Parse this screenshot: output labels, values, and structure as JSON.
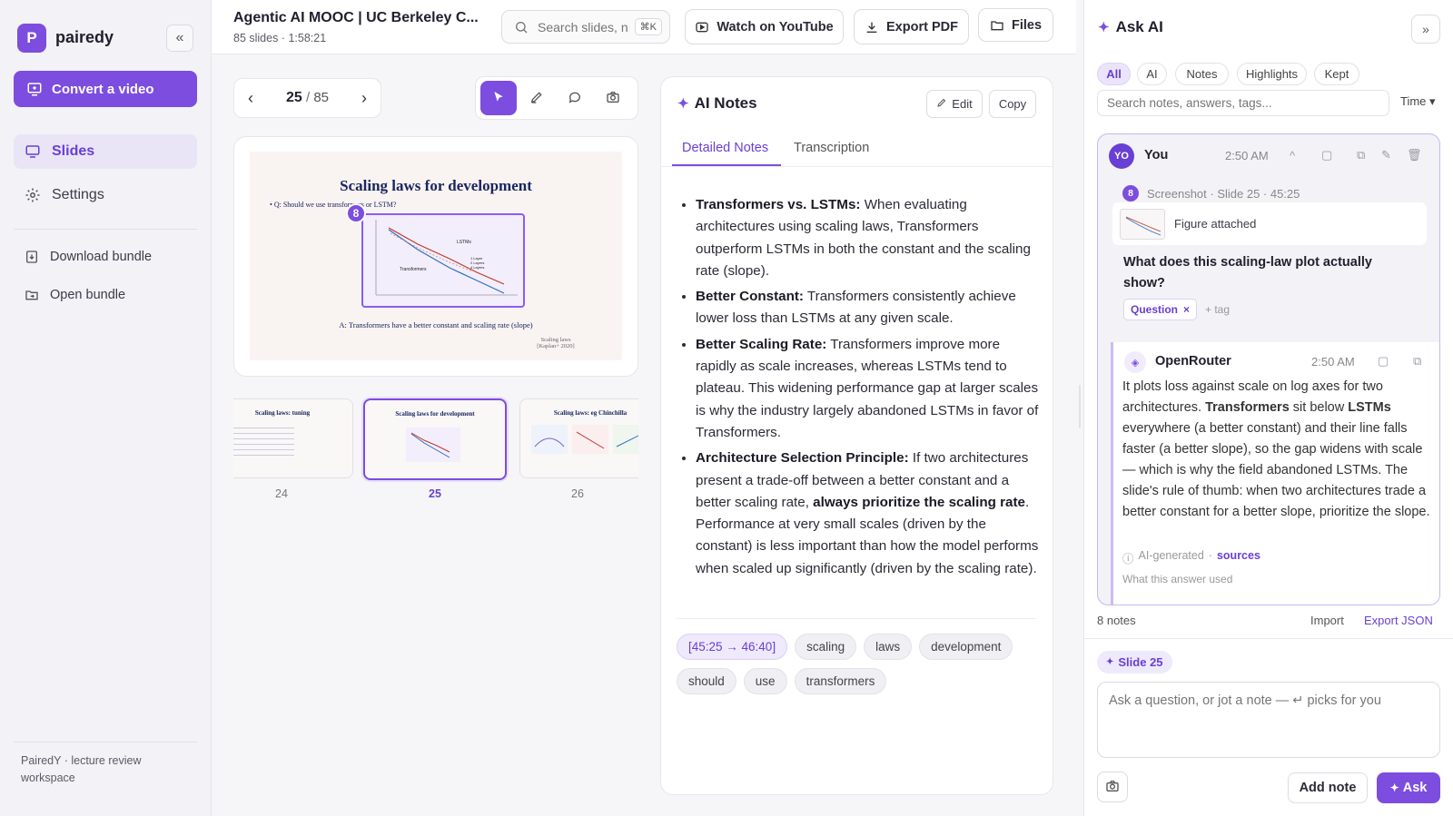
{
  "app": {
    "name": "pairedy",
    "logo_letter": "P",
    "accent": "#7c4ddf"
  },
  "sidebar": {
    "convert_label": "Convert a video",
    "nav": [
      {
        "label": "Slides",
        "icon": "monitor-icon",
        "active": true
      },
      {
        "label": "Settings",
        "icon": "gear-icon",
        "active": false
      }
    ],
    "actions": [
      {
        "label": "Download bundle",
        "icon": "download-icon"
      },
      {
        "label": "Open bundle",
        "icon": "folder-open-icon"
      }
    ],
    "footer": "PairedY · lecture review workspace"
  },
  "header": {
    "title": "Agentic AI MOOC | UC Berkeley C...",
    "subtitle": "85 slides · 1:58:21",
    "search_placeholder": "Search slides, n",
    "search_shortcut": "⌘K",
    "watch_label": "Watch on YouTube",
    "export_label": "Export PDF",
    "files_label": "Files"
  },
  "pager": {
    "current": "25",
    "separator": "/",
    "total": "85"
  },
  "slide": {
    "title": "Scaling laws for development",
    "bullet": "Q: Should we use transformers or LSTM?",
    "marker": "8",
    "series_lstm": "LSTMs",
    "series_transformers": "Transformers",
    "layer_labels": [
      "1 Layer",
      "2 Layers",
      "4 Layers"
    ],
    "answer": "A: Transformers have a better constant and scaling rate (slope)",
    "citation": "Scaling laws [Kaplan+ 2020]"
  },
  "thumbnails": [
    {
      "num": "24",
      "title": "Scaling laws: tuning"
    },
    {
      "num": "25",
      "title": "Scaling laws for development"
    },
    {
      "num": "26",
      "title": "Scaling laws: eg Chinchilla"
    }
  ],
  "notes": {
    "title": "AI Notes",
    "edit_label": "Edit",
    "copy_label": "Copy",
    "tabs": [
      "Detailed Notes",
      "Transcription"
    ],
    "bullets": [
      {
        "head": "Transformers vs. LSTMs:",
        "text": " When evaluating architectures using scaling laws, Transformers outperform LSTMs in both the constant and the scaling rate (slope)."
      },
      {
        "head": "Better Constant:",
        "text": " Transformers consistently achieve lower loss than LSTMs at any given scale."
      },
      {
        "head": "Better Scaling Rate:",
        "text": " Transformers improve more rapidly as scale increases, whereas LSTMs tend to plateau. This widening performance gap at larger scales is why the industry largely abandoned LSTMs in favor of Transformers."
      },
      {
        "head": "Architecture Selection Principle:",
        "text_a": " If two architectures present a trade-off between a better constant and a better scaling rate, ",
        "strong": "always prioritize the scaling rate",
        "text_b": ". Performance at very small scales (driven by the constant) is less important than how the model performs when scaled up significantly (driven by the scaling rate)."
      }
    ],
    "chips": [
      "[45:25 → 46:40]",
      "scaling",
      "laws",
      "development",
      "should",
      "use",
      "transformers"
    ]
  },
  "ask": {
    "title": "Ask AI",
    "filters": [
      "All",
      "AI",
      "Notes",
      "Highlights",
      "Kept"
    ],
    "search_placeholder": "Search notes, answers, tags...",
    "time_label": "Time ▾",
    "you": {
      "avatar": "YO",
      "name": "You",
      "time": "2:50 AM",
      "caret": "^"
    },
    "screenshot_badge": "8",
    "screenshot_meta": "Screenshot · Slide 25 · 45:25",
    "figure_label": "Figure attached",
    "question": "What does this scaling-law plot actually show?",
    "tag": "Question",
    "tag_remove": "×",
    "add_tag": "+ tag",
    "assistant": {
      "name": "OpenRouter",
      "time": "2:50 AM"
    },
    "answer_parts": [
      "It plots loss against scale on log axes for two architectures. ",
      "Transformers",
      " sit below ",
      "LSTMs",
      " everywhere (a better constant) and their line falls faster (a better slope), so the gap widens with scale — which is why the field abandoned LSTMs. The slide's rule of thumb: when two architectures trade a better constant for a better slope, prioritize the slope."
    ],
    "ai_generated": "AI-generated",
    "sources": "sources",
    "used_label": "What this answer used",
    "notes_count": "8 notes",
    "import_label": "Import",
    "export_label": "Export JSON",
    "slide_chip": "Slide 25",
    "input_placeholder": "Ask a question, or jot a note — ↵ picks for you",
    "add_note_label": "Add note",
    "ask_label": "Ask"
  }
}
